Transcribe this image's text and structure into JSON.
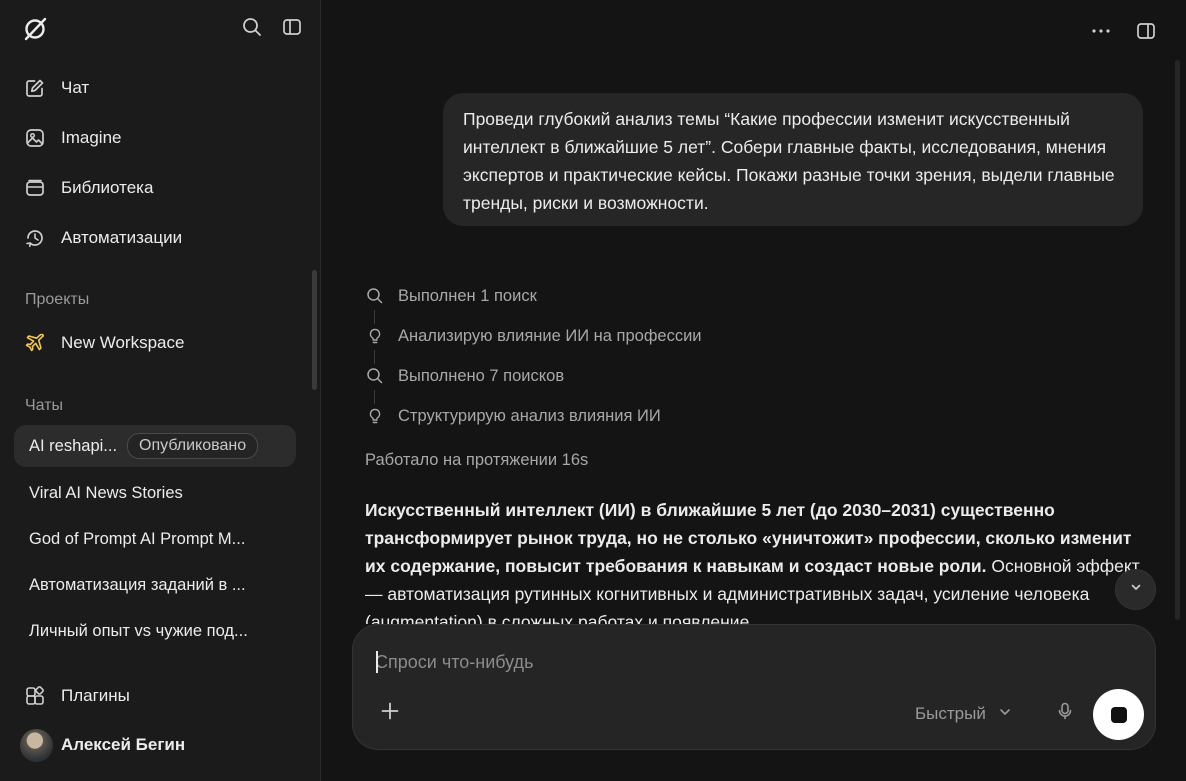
{
  "sidebar": {
    "logo_icon": "grok-logo-icon",
    "nav": [
      {
        "label": "Чат",
        "icon": "edit-icon"
      },
      {
        "label": "Imagine",
        "icon": "image-icon"
      },
      {
        "label": "Библиотека",
        "icon": "library-icon"
      },
      {
        "label": "Автоматизации",
        "icon": "clock-refresh-icon"
      }
    ],
    "projects_title": "Проекты",
    "project": {
      "label": "New Workspace",
      "icon": "plane-icon",
      "icon_color": "#f2c94c"
    },
    "chats_title": "Чаты",
    "chats": [
      {
        "label": "AI reshapi...",
        "badge": "Опубликовано",
        "active": true
      },
      {
        "label": "Viral AI News Stories"
      },
      {
        "label": "God of Prompt AI Prompt M..."
      },
      {
        "label": "Автоматизация заданий в ..."
      },
      {
        "label": "Личный опыт vs чужие под..."
      }
    ],
    "plugins_label": "Плагины",
    "user_name": "Алексей Бегин"
  },
  "main": {
    "user_message": "Проведи глубокий анализ темы “Какие профессии изменит искусственный интеллект в ближайшие 5 лет”. Собери главные факты, исследования, мнения экспертов и практические кейсы. Покажи разные точки зрения, выдели главные тренды, риски и возможности.",
    "steps": [
      {
        "icon": "search-icon",
        "text": "Выполнен 1 поиск"
      },
      {
        "icon": "lightbulb-icon",
        "text": "Анализирую влияние ИИ на профессии"
      },
      {
        "icon": "search-icon",
        "text": "Выполнено 7 поисков"
      },
      {
        "icon": "lightbulb-icon",
        "text": "Структурирую анализ влияния ИИ"
      }
    ],
    "worked_for": "Работало на протяжении 16s",
    "answer_bold": "Искусственный интеллект (ИИ) в ближайшие 5 лет (до 2030–2031) существенно трансформирует рынок труда, но не столько «уничтожит» профессии, сколько изменит их содержание, повысит требования к навыкам и создаст новые роли.",
    "answer_rest": " Основной эффект — автоматизация рутинных когнитивных и административных задач, усиление человека (augmentation) в сложных работах и появление"
  },
  "composer": {
    "placeholder": "Спроси что-нибудь",
    "mode_label": "Быстрый"
  }
}
